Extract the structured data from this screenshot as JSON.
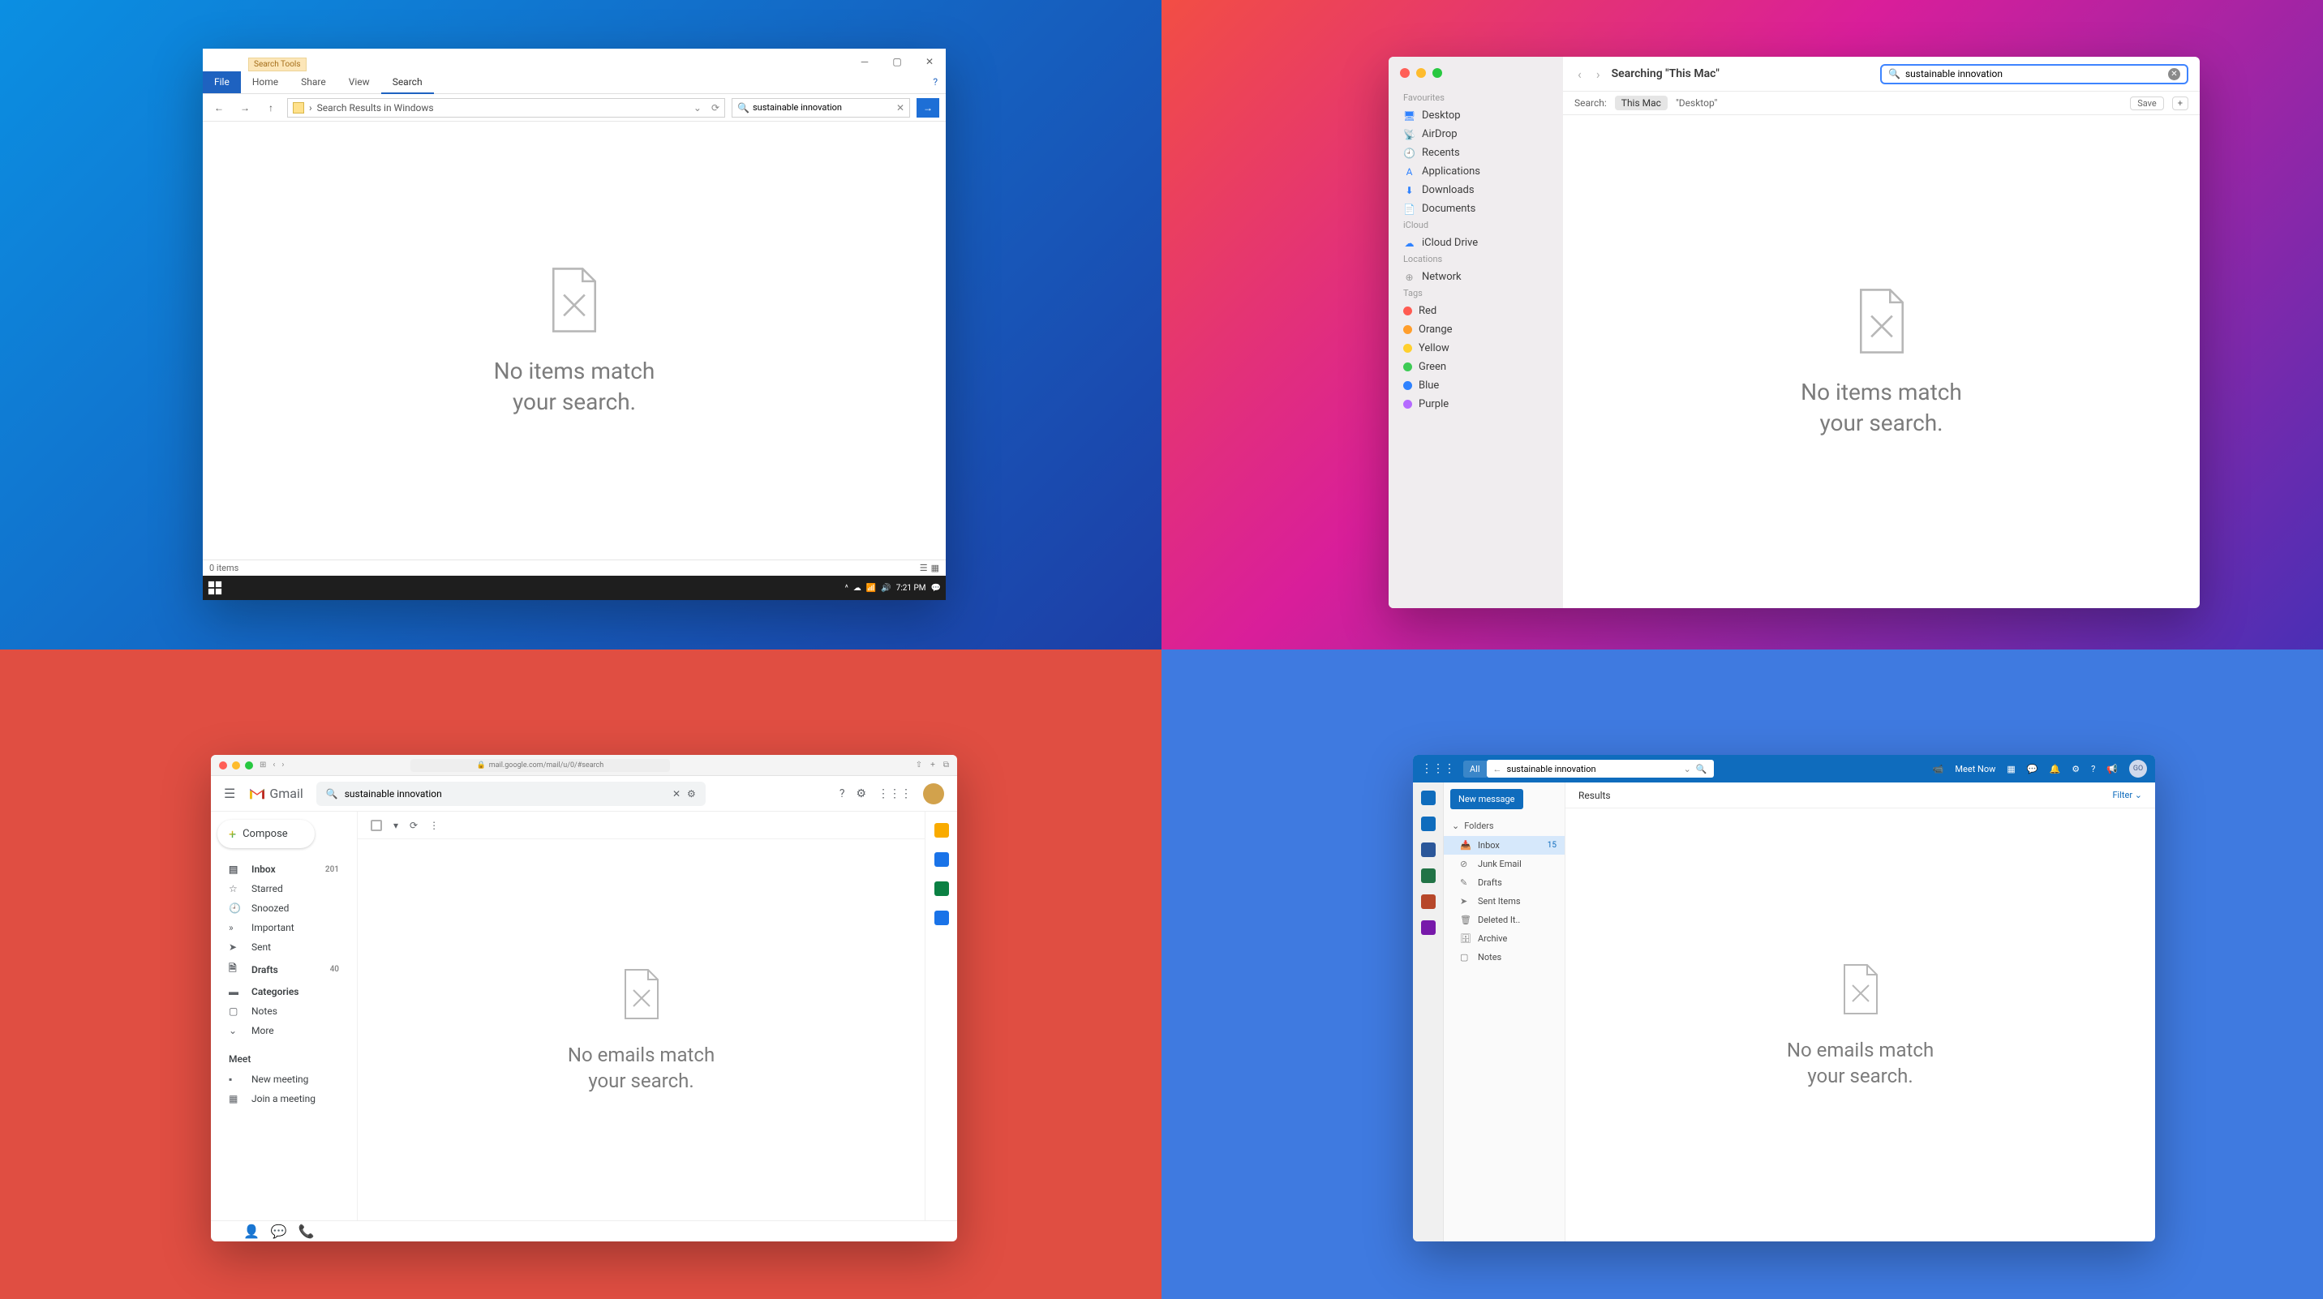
{
  "win": {
    "search_tools": "Search Tools",
    "ribbon": {
      "file": "File",
      "home": "Home",
      "share": "Share",
      "view": "View",
      "search": "Search"
    },
    "path": "Search Results in Windows",
    "search_value": "sustainable innovation",
    "empty_l1": "No items match",
    "empty_l2": "your search.",
    "status": "0 items",
    "clock": "7:21 PM"
  },
  "mac": {
    "title": "Searching \"This Mac\"",
    "search_value": "sustainable innovation",
    "filter_label": "Search:",
    "scope_thismac": "This Mac",
    "scope_desktop": "\"Desktop\"",
    "save": "Save",
    "sec_fav": "Favourites",
    "sec_icloud": "iCloud",
    "sec_loc": "Locations",
    "sec_tags": "Tags",
    "fav": [
      "Desktop",
      "AirDrop",
      "Recents",
      "Applications",
      "Downloads",
      "Documents"
    ],
    "icloud": [
      "iCloud Drive"
    ],
    "loc": [
      "Network"
    ],
    "tags": [
      {
        "n": "Red",
        "c": "#ff5b52"
      },
      {
        "n": "Orange",
        "c": "#ff9e2c"
      },
      {
        "n": "Yellow",
        "c": "#ffd02e"
      },
      {
        "n": "Green",
        "c": "#3ecb55"
      },
      {
        "n": "Blue",
        "c": "#2f82ff"
      },
      {
        "n": "Purple",
        "c": "#b56aff"
      }
    ],
    "empty_l1": "No items match",
    "empty_l2": "your search."
  },
  "gm": {
    "url": "mail.google.com/mail/u/0/#search",
    "brand": "Gmail",
    "search_value": "sustainable innovation",
    "compose": "Compose",
    "nav": [
      {
        "ico": "inbox",
        "label": "Inbox",
        "cnt": "201",
        "bold": true
      },
      {
        "ico": "star",
        "label": "Starred"
      },
      {
        "ico": "clock",
        "label": "Snoozed"
      },
      {
        "ico": "flag",
        "label": "Important"
      },
      {
        "ico": "send",
        "label": "Sent"
      },
      {
        "ico": "file",
        "label": "Drafts",
        "cnt": "40",
        "bold": true
      },
      {
        "ico": "cat",
        "label": "Categories",
        "bold": true
      },
      {
        "ico": "note",
        "label": "Notes"
      },
      {
        "ico": "more",
        "label": "More"
      }
    ],
    "meet": "Meet",
    "meet_new": "New meeting",
    "meet_join": "Join a meeting",
    "empty_l1": "No emails match",
    "empty_l2": "your search.",
    "rr": [
      "#f9ab00",
      "#1a73e8",
      "#0b8043",
      "#1a73e8"
    ]
  },
  "ol": {
    "scope": "All",
    "search_value": "sustainable innovation",
    "meet": "Meet Now",
    "newmsg": "New message",
    "folders_h": "Folders",
    "folders": [
      {
        "ico": "inbox",
        "label": "Inbox",
        "cnt": "15",
        "sel": true
      },
      {
        "ico": "junk",
        "label": "Junk Email"
      },
      {
        "ico": "draft",
        "label": "Drafts"
      },
      {
        "ico": "sent",
        "label": "Sent Items"
      },
      {
        "ico": "del",
        "label": "Deleted It.."
      },
      {
        "ico": "arch",
        "label": "Archive"
      },
      {
        "ico": "note",
        "label": "Notes"
      }
    ],
    "results": "Results",
    "filter": "Filter",
    "rail": [
      "#0f6cbd",
      "#0f6cbd",
      "#2b579a",
      "#217346",
      "#b7472a",
      "#7719aa"
    ],
    "empty_l1": "No emails match",
    "empty_l2": "your search."
  }
}
